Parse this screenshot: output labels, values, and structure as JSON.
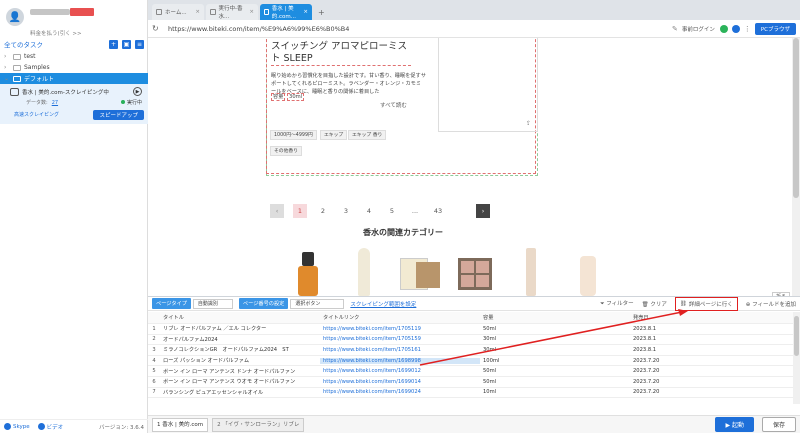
{
  "sidebar": {
    "upgrade_label": "料金を払う(引く >>",
    "toolbar_title": "全てのタスク",
    "tree": [
      {
        "label": "test"
      },
      {
        "label": "Samples"
      },
      {
        "label": "デフォルト"
      }
    ],
    "task": {
      "title": "香水 | 美的.com-スクレイピング中",
      "data_label": "データ数:",
      "data_count": "27",
      "status": "実行中",
      "mode": "高速スクレイピング",
      "speedup_label": "スピードアップ"
    },
    "footer": {
      "skype_label": "Skype",
      "video_label": "ビデオ",
      "version": "バージョン: 3.6.4"
    }
  },
  "browser": {
    "tabs": [
      {
        "label": "ホーム..."
      },
      {
        "label": "実行中-香水..."
      },
      {
        "label": "香水 | 美的.com..."
      }
    ],
    "url": "https://www.biteki.com/item/%E9%A6%99%E6%B0%B4",
    "prelogin_label": "事前ログイン",
    "pc_browser_label": "PCブラウザ"
  },
  "page": {
    "product_title": "スイッチング アロマピローミスト SLEEP",
    "product_desc": "眠り始めから習慣化を目指した設計です。甘い香り、睡眠を促すサポートしてくれるピローミスト。ラベンダー・オレンジ・カモミールをベースに、睡眠と香りの関係に着目した",
    "capacity_label": "容量",
    "capacity_value": "30ml",
    "more_label": "すべて読む",
    "tags": [
      "1000円〜4999円",
      "エキップ",
      "エキップ 香り",
      "その他香り"
    ],
    "pager": [
      "1",
      "2",
      "3",
      "4",
      "5",
      "...",
      "43"
    ],
    "related_title": "香水の関連カテゴリー",
    "fold_label": "折る"
  },
  "panel": {
    "page_type_label": "ページタイプ",
    "page_type_value": "自動識別",
    "page_turn_label": "ページ番号の設定",
    "page_turn_value": "選択ボタン",
    "scrape_range_label": "スクレイピング範囲を設定",
    "filter_label": "フィルター",
    "clear_label": "クリア",
    "detail_label": "詳細ページに行く",
    "add_field_label": "フィールドを追加",
    "columns": [
      "タイトル",
      "タイトルリンク",
      "容量",
      "発売日"
    ],
    "rows": [
      {
        "n": "1",
        "title": "リブレ オードパルファム ／エル コレクター",
        "link": "https://www.biteki.com/item/1705119",
        "cap": "50ml",
        "date": "2023.8.1"
      },
      {
        "n": "2",
        "title": "オードパルファム2024",
        "link": "https://www.biteki.com/item/1705159",
        "cap": "30ml",
        "date": "2023.8.1"
      },
      {
        "n": "3",
        "title": "ミラノコレクションGR　オードパルファム2024　ST",
        "link": "https://www.biteki.com/item/1705161",
        "cap": "30ml",
        "date": "2023.8.1"
      },
      {
        "n": "4",
        "title": "ローズ パッション オードパルファム",
        "link": "https://www.biteki.com/item/1698998",
        "cap": "100ml",
        "date": "2023.7.20"
      },
      {
        "n": "5",
        "title": "ボーン イン ローマ アンテンス ドンナ オードパルファン",
        "link": "https://www.biteki.com/item/1699012",
        "cap": "50ml",
        "date": "2023.7.20"
      },
      {
        "n": "6",
        "title": "ボーン イン ローマ アンテンス ウオモ オードパルファン",
        "link": "https://www.biteki.com/item/1699014",
        "cap": "50ml",
        "date": "2023.7.20"
      },
      {
        "n": "7",
        "title": "バランシング ピュアエッセンシャルオイル",
        "link": "https://www.biteki.com/item/1699024",
        "cap": "10ml",
        "date": "2023.7.20"
      }
    ],
    "bottom_tabs": [
      "1  香水 | 美的.com",
      "2  「イヴ・サンローラン」リブレ"
    ],
    "start_label": "起動",
    "save_label": "保存"
  },
  "colors": {
    "accent": "#1e6fd9",
    "active_tab": "#1e8de0",
    "annotation_red": "#e02020",
    "status_green": "#29b05a"
  }
}
